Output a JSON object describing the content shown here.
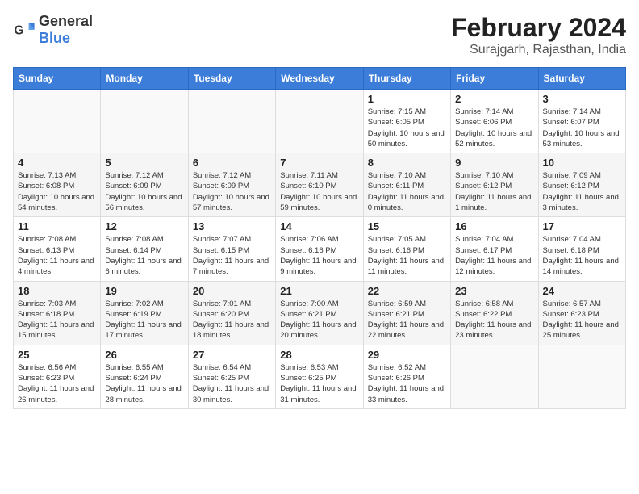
{
  "header": {
    "logo": {
      "general": "General",
      "blue": "Blue"
    },
    "title": "February 2024",
    "location": "Surajgarh, Rajasthan, India"
  },
  "calendar": {
    "days_of_week": [
      "Sunday",
      "Monday",
      "Tuesday",
      "Wednesday",
      "Thursday",
      "Friday",
      "Saturday"
    ],
    "weeks": [
      [
        {
          "day": "",
          "info": ""
        },
        {
          "day": "",
          "info": ""
        },
        {
          "day": "",
          "info": ""
        },
        {
          "day": "",
          "info": ""
        },
        {
          "day": "1",
          "info": "Sunrise: 7:15 AM\nSunset: 6:05 PM\nDaylight: 10 hours and 50 minutes."
        },
        {
          "day": "2",
          "info": "Sunrise: 7:14 AM\nSunset: 6:06 PM\nDaylight: 10 hours and 52 minutes."
        },
        {
          "day": "3",
          "info": "Sunrise: 7:14 AM\nSunset: 6:07 PM\nDaylight: 10 hours and 53 minutes."
        }
      ],
      [
        {
          "day": "4",
          "info": "Sunrise: 7:13 AM\nSunset: 6:08 PM\nDaylight: 10 hours and 54 minutes."
        },
        {
          "day": "5",
          "info": "Sunrise: 7:12 AM\nSunset: 6:09 PM\nDaylight: 10 hours and 56 minutes."
        },
        {
          "day": "6",
          "info": "Sunrise: 7:12 AM\nSunset: 6:09 PM\nDaylight: 10 hours and 57 minutes."
        },
        {
          "day": "7",
          "info": "Sunrise: 7:11 AM\nSunset: 6:10 PM\nDaylight: 10 hours and 59 minutes."
        },
        {
          "day": "8",
          "info": "Sunrise: 7:10 AM\nSunset: 6:11 PM\nDaylight: 11 hours and 0 minutes."
        },
        {
          "day": "9",
          "info": "Sunrise: 7:10 AM\nSunset: 6:12 PM\nDaylight: 11 hours and 1 minute."
        },
        {
          "day": "10",
          "info": "Sunrise: 7:09 AM\nSunset: 6:12 PM\nDaylight: 11 hours and 3 minutes."
        }
      ],
      [
        {
          "day": "11",
          "info": "Sunrise: 7:08 AM\nSunset: 6:13 PM\nDaylight: 11 hours and 4 minutes."
        },
        {
          "day": "12",
          "info": "Sunrise: 7:08 AM\nSunset: 6:14 PM\nDaylight: 11 hours and 6 minutes."
        },
        {
          "day": "13",
          "info": "Sunrise: 7:07 AM\nSunset: 6:15 PM\nDaylight: 11 hours and 7 minutes."
        },
        {
          "day": "14",
          "info": "Sunrise: 7:06 AM\nSunset: 6:16 PM\nDaylight: 11 hours and 9 minutes."
        },
        {
          "day": "15",
          "info": "Sunrise: 7:05 AM\nSunset: 6:16 PM\nDaylight: 11 hours and 11 minutes."
        },
        {
          "day": "16",
          "info": "Sunrise: 7:04 AM\nSunset: 6:17 PM\nDaylight: 11 hours and 12 minutes."
        },
        {
          "day": "17",
          "info": "Sunrise: 7:04 AM\nSunset: 6:18 PM\nDaylight: 11 hours and 14 minutes."
        }
      ],
      [
        {
          "day": "18",
          "info": "Sunrise: 7:03 AM\nSunset: 6:18 PM\nDaylight: 11 hours and 15 minutes."
        },
        {
          "day": "19",
          "info": "Sunrise: 7:02 AM\nSunset: 6:19 PM\nDaylight: 11 hours and 17 minutes."
        },
        {
          "day": "20",
          "info": "Sunrise: 7:01 AM\nSunset: 6:20 PM\nDaylight: 11 hours and 18 minutes."
        },
        {
          "day": "21",
          "info": "Sunrise: 7:00 AM\nSunset: 6:21 PM\nDaylight: 11 hours and 20 minutes."
        },
        {
          "day": "22",
          "info": "Sunrise: 6:59 AM\nSunset: 6:21 PM\nDaylight: 11 hours and 22 minutes."
        },
        {
          "day": "23",
          "info": "Sunrise: 6:58 AM\nSunset: 6:22 PM\nDaylight: 11 hours and 23 minutes."
        },
        {
          "day": "24",
          "info": "Sunrise: 6:57 AM\nSunset: 6:23 PM\nDaylight: 11 hours and 25 minutes."
        }
      ],
      [
        {
          "day": "25",
          "info": "Sunrise: 6:56 AM\nSunset: 6:23 PM\nDaylight: 11 hours and 26 minutes."
        },
        {
          "day": "26",
          "info": "Sunrise: 6:55 AM\nSunset: 6:24 PM\nDaylight: 11 hours and 28 minutes."
        },
        {
          "day": "27",
          "info": "Sunrise: 6:54 AM\nSunset: 6:25 PM\nDaylight: 11 hours and 30 minutes."
        },
        {
          "day": "28",
          "info": "Sunrise: 6:53 AM\nSunset: 6:25 PM\nDaylight: 11 hours and 31 minutes."
        },
        {
          "day": "29",
          "info": "Sunrise: 6:52 AM\nSunset: 6:26 PM\nDaylight: 11 hours and 33 minutes."
        },
        {
          "day": "",
          "info": ""
        },
        {
          "day": "",
          "info": ""
        }
      ]
    ]
  }
}
